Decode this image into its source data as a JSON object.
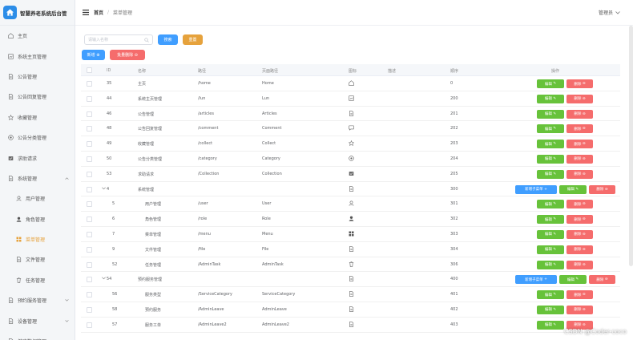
{
  "app": {
    "title": "智慧养老系统后台管"
  },
  "sidebar": {
    "items": [
      {
        "label": "主页",
        "icon": "home-icon",
        "type": "top"
      },
      {
        "label": "系统主页管理",
        "icon": "layout-icon",
        "type": "top"
      },
      {
        "label": "公告管理",
        "icon": "document-icon",
        "type": "top"
      },
      {
        "label": "公告回复管理",
        "icon": "document-icon",
        "type": "top"
      },
      {
        "label": "收藏管理",
        "icon": "star-icon",
        "type": "top"
      },
      {
        "label": "公告分类管理",
        "icon": "category-icon",
        "type": "top"
      },
      {
        "label": "求助请求",
        "icon": "collection-icon",
        "type": "top"
      },
      {
        "label": "系统管理",
        "icon": "document-icon",
        "type": "top",
        "expanded": true
      },
      {
        "label": "用户管理",
        "icon": "user-icon",
        "type": "sub"
      },
      {
        "label": "角色管理",
        "icon": "user-filled-icon",
        "type": "sub"
      },
      {
        "label": "菜单管理",
        "icon": "menu-icon",
        "type": "sub",
        "active": true
      },
      {
        "label": "文件管理",
        "icon": "document-icon",
        "type": "sub"
      },
      {
        "label": "任务管理",
        "icon": "trash-icon",
        "type": "sub"
      },
      {
        "label": "预约服务管理",
        "icon": "document-icon",
        "type": "top"
      },
      {
        "label": "设备管理",
        "icon": "document-icon",
        "type": "top"
      },
      {
        "label": "健康数据管理",
        "icon": "document-icon",
        "type": "top"
      }
    ]
  },
  "header": {
    "breadcrumb": [
      "首页",
      "菜单管理"
    ],
    "user": "管理员"
  },
  "toolbar": {
    "search_placeholder": "请输入名称",
    "search_label": "搜索",
    "reset_label": "重置",
    "add_label": "新增",
    "batch_delete_label": "批量删除"
  },
  "table": {
    "columns": [
      "ID",
      "名称",
      "路径",
      "页面路径",
      "图标",
      "描述",
      "顺序",
      "操作"
    ],
    "rows": [
      {
        "id": "35",
        "name": "主页",
        "path": "/home",
        "page": "Home",
        "icon": "house-icon",
        "desc": "",
        "order": "0",
        "level": 0,
        "add": false
      },
      {
        "id": "44",
        "name": "系统主页管理",
        "path": "/lun",
        "page": "Lun",
        "icon": "layout-icon",
        "desc": "",
        "order": "200",
        "level": 0,
        "add": false
      },
      {
        "id": "46",
        "name": "公告管理",
        "path": "/articles",
        "page": "Articles",
        "icon": "document-icon",
        "desc": "",
        "order": "201",
        "level": 0,
        "add": false
      },
      {
        "id": "48",
        "name": "公告回复管理",
        "path": "/comment",
        "page": "Comment",
        "icon": "chat-icon",
        "desc": "",
        "order": "202",
        "level": 0,
        "add": false
      },
      {
        "id": "49",
        "name": "收藏管理",
        "path": "/collect",
        "page": "Collect",
        "icon": "star-icon",
        "desc": "",
        "order": "203",
        "level": 0,
        "add": false
      },
      {
        "id": "50",
        "name": "公告分类管理",
        "path": "/category",
        "page": "Category",
        "icon": "category-icon",
        "desc": "",
        "order": "204",
        "level": 0,
        "add": false
      },
      {
        "id": "53",
        "name": "求助请求",
        "path": "/Collection",
        "page": "Collection",
        "icon": "collection-icon",
        "desc": "",
        "order": "205",
        "level": 0,
        "add": false
      },
      {
        "id": "4",
        "name": "系统管理",
        "path": "",
        "page": "",
        "icon": "document-icon",
        "desc": "",
        "order": "300",
        "level": 0,
        "add": true,
        "expand": true
      },
      {
        "id": "5",
        "name": "用户管理",
        "path": "/user",
        "page": "User",
        "icon": "user-icon",
        "desc": "",
        "order": "301",
        "level": 1,
        "add": false
      },
      {
        "id": "6",
        "name": "角色管理",
        "path": "/role",
        "page": "Role",
        "icon": "user-filled-icon",
        "desc": "",
        "order": "302",
        "level": 1,
        "add": false
      },
      {
        "id": "7",
        "name": "菜单管理",
        "path": "/menu",
        "page": "Menu",
        "icon": "menu-icon",
        "desc": "",
        "order": "303",
        "level": 1,
        "add": false
      },
      {
        "id": "9",
        "name": "文件管理",
        "path": "/file",
        "page": "File",
        "icon": "document-icon",
        "desc": "",
        "order": "304",
        "level": 1,
        "add": false
      },
      {
        "id": "52",
        "name": "任务管理",
        "path": "/AdminTask",
        "page": "AdminTask",
        "icon": "trash-icon",
        "desc": "",
        "order": "306",
        "level": 1,
        "add": false
      },
      {
        "id": "54",
        "name": "预约服务管理",
        "path": "",
        "page": "",
        "icon": "document-icon",
        "desc": "",
        "order": "400",
        "level": 0,
        "add": true,
        "expand": true
      },
      {
        "id": "56",
        "name": "服务类型",
        "path": "/ServiceCategory",
        "page": "ServiceCategory",
        "icon": "document-icon",
        "desc": "",
        "order": "401",
        "level": 1,
        "add": false
      },
      {
        "id": "58",
        "name": "预约服务",
        "path": "/AdminLeave",
        "page": "AdminLeave",
        "icon": "document-icon",
        "desc": "",
        "order": "402",
        "level": 1,
        "add": false
      },
      {
        "id": "57",
        "name": "服务工单",
        "path": "/AdminLeave2",
        "page": "AdminLeave2",
        "icon": "document-icon",
        "desc": "",
        "order": "403",
        "level": 1,
        "add": false
      }
    ],
    "edit_label": "编辑",
    "delete_label": "删除",
    "add_child_label": "新增子菜单"
  },
  "watermark": "CSDN @Coder-coco",
  "colors": {
    "primary": "#409eff",
    "success": "#67c23a",
    "warning": "#e6a23c",
    "danger": "#f56c6c",
    "active_menu": "#e6a23c"
  }
}
